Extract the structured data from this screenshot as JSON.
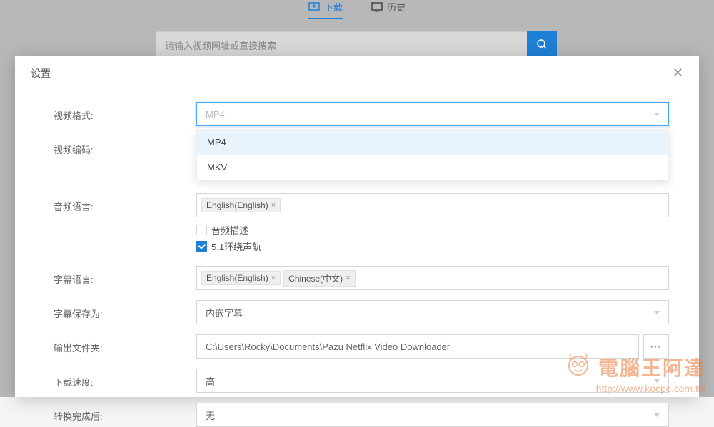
{
  "backdrop": {
    "tab_download": "下载",
    "tab_history": "历史",
    "search_placeholder": "请输入视频网址或直接搜索"
  },
  "modal": {
    "title": "设置"
  },
  "labels": {
    "video_format": "视频格式:",
    "video_codec": "视频编码:",
    "audio_language": "音频语言:",
    "audio_desc": "音频描述",
    "surround_51": "5.1环绕声轨",
    "subtitle_language": "字幕语言:",
    "subtitle_save_as": "字幕保存为:",
    "output_folder": "输出文件夹:",
    "download_speed": "下载速度:",
    "after_convert": "转换完成后:"
  },
  "values": {
    "video_format_selected": "MP4",
    "format_options": [
      "MP4",
      "MKV"
    ],
    "audio_tags": [
      "English(English)"
    ],
    "subtitle_tags": [
      "English(English)",
      "Chinese(中文)"
    ],
    "subtitle_save_as": "内嵌字幕",
    "output_folder": "C:\\Users\\Rocky\\Documents\\Pazu Netflix Video Downloader",
    "download_speed": "高",
    "after_convert": "无",
    "browse_label": "···"
  },
  "checks": {
    "audio_desc": false,
    "surround_51": true
  },
  "watermark": {
    "title": "電腦王阿達",
    "url": "http://www.kocpc.com.tw"
  }
}
